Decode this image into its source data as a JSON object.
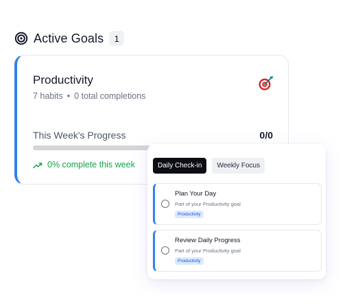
{
  "header": {
    "title": "Active Goals",
    "count": "1",
    "icon": "target-icon"
  },
  "goal": {
    "title": "Productivity",
    "habits_text": "7 habits",
    "separator": "•",
    "completions_text": "0 total completions",
    "icon": "dart-icon",
    "progress_label": "This Week's Progress",
    "progress_count": "0/0",
    "progress_fraction": 0,
    "complete_text": "0% complete this week",
    "accent_color": "#2f80ed",
    "success_color": "#16a34a"
  },
  "checkin": {
    "tabs": [
      {
        "label": "Daily Check-in",
        "active": true
      },
      {
        "label": "Weekly Focus",
        "active": false
      }
    ],
    "habits": [
      {
        "name": "Plan Your Day",
        "subtitle": "Part of your Productivity goal",
        "tag": "Productivity",
        "checked": false
      },
      {
        "name": "Review Daily Progress",
        "subtitle": "Part of your Productivity goal",
        "tag": "Productivity",
        "checked": false
      }
    ]
  }
}
